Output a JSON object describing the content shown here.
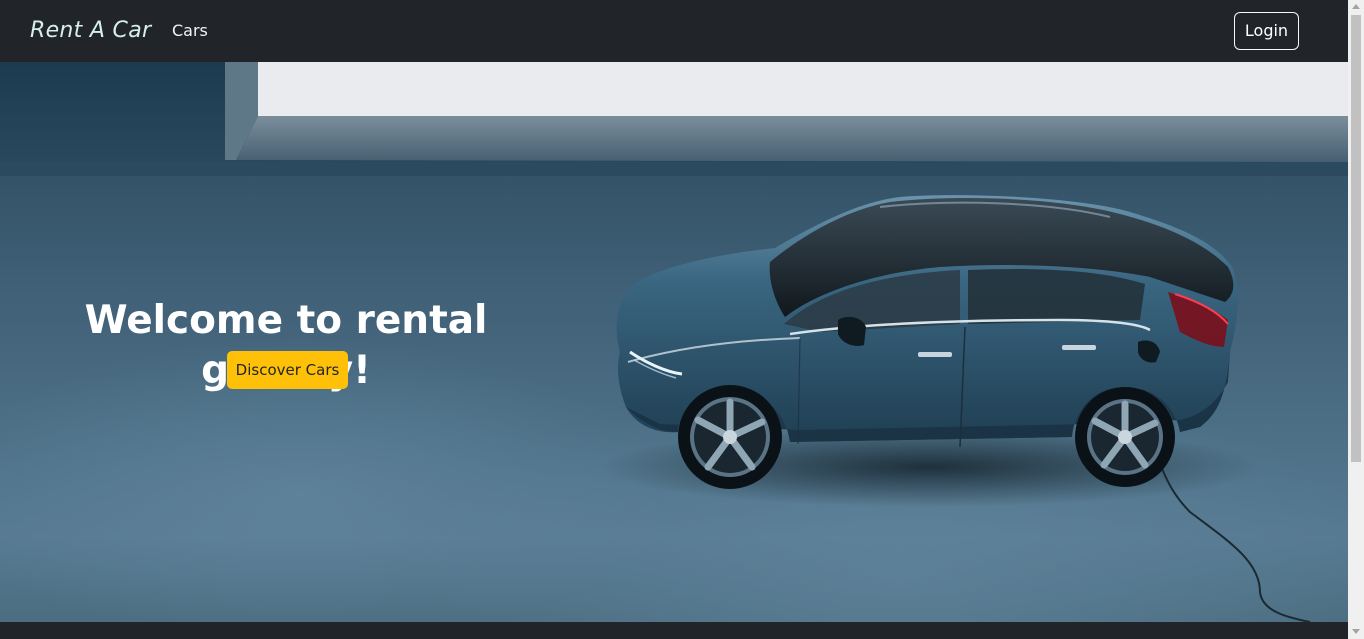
{
  "navbar": {
    "brand": "Rent A Car",
    "links": [
      {
        "label": "Cars"
      }
    ],
    "login_label": "Login"
  },
  "hero": {
    "title": "Welcome to rental gallery!",
    "cta_label": "Discover Cars",
    "image": "car-photo"
  },
  "colors": {
    "navbar_bg": "#212529",
    "cta_bg": "#ffc107",
    "car_body": "#2e5670",
    "hero_bg": "#4d7188"
  }
}
